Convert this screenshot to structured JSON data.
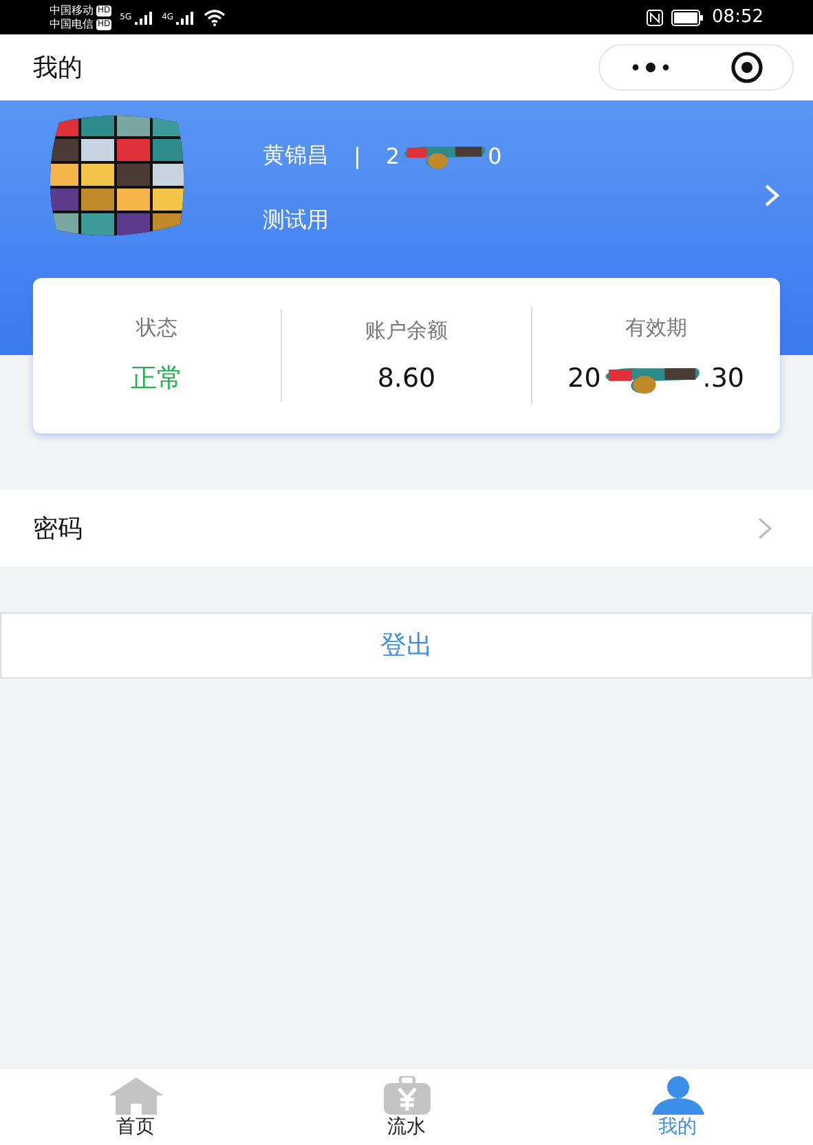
{
  "status_bar": {
    "carriers": [
      {
        "name": "中国移动",
        "badge": "HD",
        "network": "5G"
      },
      {
        "name": "中国电信",
        "badge": "HD",
        "network": "4G"
      }
    ],
    "time": "08:52"
  },
  "header": {
    "title": "我的"
  },
  "profile": {
    "name": "黄锦昌",
    "separator": "|",
    "id_parts": [
      "2",
      "0"
    ],
    "role": "测试用"
  },
  "stats": [
    {
      "label": "状态",
      "value_parts": [
        "正常"
      ],
      "kind": "status"
    },
    {
      "label": "账户余额",
      "value_parts": [
        "8.60"
      ],
      "kind": "plain"
    },
    {
      "label": "有效期",
      "value_parts": [
        "20",
        ".30"
      ],
      "kind": "redacted"
    }
  ],
  "menu": [
    {
      "label": "密码"
    }
  ],
  "logout": {
    "label": "登出"
  },
  "tabs": [
    {
      "label": "首页",
      "kind": "home",
      "selected": false
    },
    {
      "label": "流水",
      "kind": "wallet",
      "selected": false
    },
    {
      "label": "我的",
      "kind": "person",
      "selected": true
    }
  ]
}
